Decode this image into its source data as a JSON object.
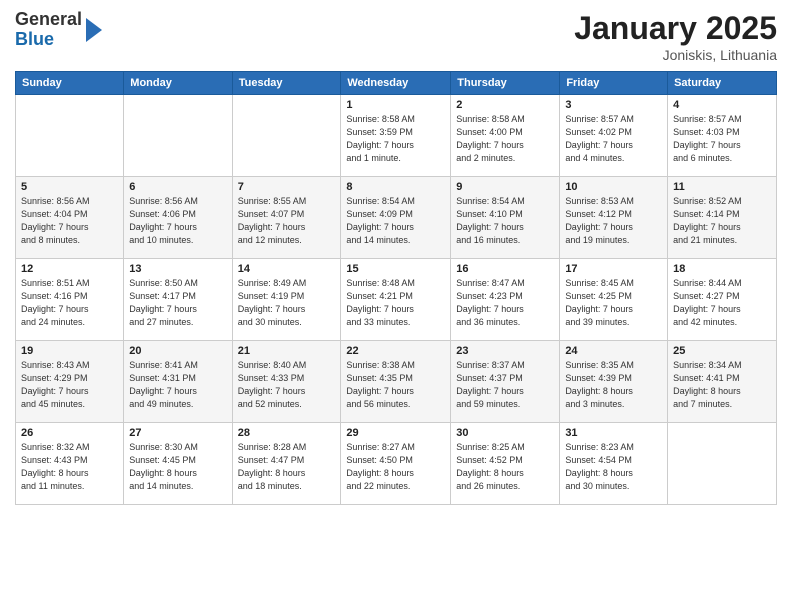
{
  "logo": {
    "general": "General",
    "blue": "Blue"
  },
  "title": "January 2025",
  "location": "Joniskis, Lithuania",
  "headers": [
    "Sunday",
    "Monday",
    "Tuesday",
    "Wednesday",
    "Thursday",
    "Friday",
    "Saturday"
  ],
  "weeks": [
    [
      {
        "day": "",
        "info": ""
      },
      {
        "day": "",
        "info": ""
      },
      {
        "day": "",
        "info": ""
      },
      {
        "day": "1",
        "info": "Sunrise: 8:58 AM\nSunset: 3:59 PM\nDaylight: 7 hours\nand 1 minute."
      },
      {
        "day": "2",
        "info": "Sunrise: 8:58 AM\nSunset: 4:00 PM\nDaylight: 7 hours\nand 2 minutes."
      },
      {
        "day": "3",
        "info": "Sunrise: 8:57 AM\nSunset: 4:02 PM\nDaylight: 7 hours\nand 4 minutes."
      },
      {
        "day": "4",
        "info": "Sunrise: 8:57 AM\nSunset: 4:03 PM\nDaylight: 7 hours\nand 6 minutes."
      }
    ],
    [
      {
        "day": "5",
        "info": "Sunrise: 8:56 AM\nSunset: 4:04 PM\nDaylight: 7 hours\nand 8 minutes."
      },
      {
        "day": "6",
        "info": "Sunrise: 8:56 AM\nSunset: 4:06 PM\nDaylight: 7 hours\nand 10 minutes."
      },
      {
        "day": "7",
        "info": "Sunrise: 8:55 AM\nSunset: 4:07 PM\nDaylight: 7 hours\nand 12 minutes."
      },
      {
        "day": "8",
        "info": "Sunrise: 8:54 AM\nSunset: 4:09 PM\nDaylight: 7 hours\nand 14 minutes."
      },
      {
        "day": "9",
        "info": "Sunrise: 8:54 AM\nSunset: 4:10 PM\nDaylight: 7 hours\nand 16 minutes."
      },
      {
        "day": "10",
        "info": "Sunrise: 8:53 AM\nSunset: 4:12 PM\nDaylight: 7 hours\nand 19 minutes."
      },
      {
        "day": "11",
        "info": "Sunrise: 8:52 AM\nSunset: 4:14 PM\nDaylight: 7 hours\nand 21 minutes."
      }
    ],
    [
      {
        "day": "12",
        "info": "Sunrise: 8:51 AM\nSunset: 4:16 PM\nDaylight: 7 hours\nand 24 minutes."
      },
      {
        "day": "13",
        "info": "Sunrise: 8:50 AM\nSunset: 4:17 PM\nDaylight: 7 hours\nand 27 minutes."
      },
      {
        "day": "14",
        "info": "Sunrise: 8:49 AM\nSunset: 4:19 PM\nDaylight: 7 hours\nand 30 minutes."
      },
      {
        "day": "15",
        "info": "Sunrise: 8:48 AM\nSunset: 4:21 PM\nDaylight: 7 hours\nand 33 minutes."
      },
      {
        "day": "16",
        "info": "Sunrise: 8:47 AM\nSunset: 4:23 PM\nDaylight: 7 hours\nand 36 minutes."
      },
      {
        "day": "17",
        "info": "Sunrise: 8:45 AM\nSunset: 4:25 PM\nDaylight: 7 hours\nand 39 minutes."
      },
      {
        "day": "18",
        "info": "Sunrise: 8:44 AM\nSunset: 4:27 PM\nDaylight: 7 hours\nand 42 minutes."
      }
    ],
    [
      {
        "day": "19",
        "info": "Sunrise: 8:43 AM\nSunset: 4:29 PM\nDaylight: 7 hours\nand 45 minutes."
      },
      {
        "day": "20",
        "info": "Sunrise: 8:41 AM\nSunset: 4:31 PM\nDaylight: 7 hours\nand 49 minutes."
      },
      {
        "day": "21",
        "info": "Sunrise: 8:40 AM\nSunset: 4:33 PM\nDaylight: 7 hours\nand 52 minutes."
      },
      {
        "day": "22",
        "info": "Sunrise: 8:38 AM\nSunset: 4:35 PM\nDaylight: 7 hours\nand 56 minutes."
      },
      {
        "day": "23",
        "info": "Sunrise: 8:37 AM\nSunset: 4:37 PM\nDaylight: 7 hours\nand 59 minutes."
      },
      {
        "day": "24",
        "info": "Sunrise: 8:35 AM\nSunset: 4:39 PM\nDaylight: 8 hours\nand 3 minutes."
      },
      {
        "day": "25",
        "info": "Sunrise: 8:34 AM\nSunset: 4:41 PM\nDaylight: 8 hours\nand 7 minutes."
      }
    ],
    [
      {
        "day": "26",
        "info": "Sunrise: 8:32 AM\nSunset: 4:43 PM\nDaylight: 8 hours\nand 11 minutes."
      },
      {
        "day": "27",
        "info": "Sunrise: 8:30 AM\nSunset: 4:45 PM\nDaylight: 8 hours\nand 14 minutes."
      },
      {
        "day": "28",
        "info": "Sunrise: 8:28 AM\nSunset: 4:47 PM\nDaylight: 8 hours\nand 18 minutes."
      },
      {
        "day": "29",
        "info": "Sunrise: 8:27 AM\nSunset: 4:50 PM\nDaylight: 8 hours\nand 22 minutes."
      },
      {
        "day": "30",
        "info": "Sunrise: 8:25 AM\nSunset: 4:52 PM\nDaylight: 8 hours\nand 26 minutes."
      },
      {
        "day": "31",
        "info": "Sunrise: 8:23 AM\nSunset: 4:54 PM\nDaylight: 8 hours\nand 30 minutes."
      },
      {
        "day": "",
        "info": ""
      }
    ]
  ]
}
